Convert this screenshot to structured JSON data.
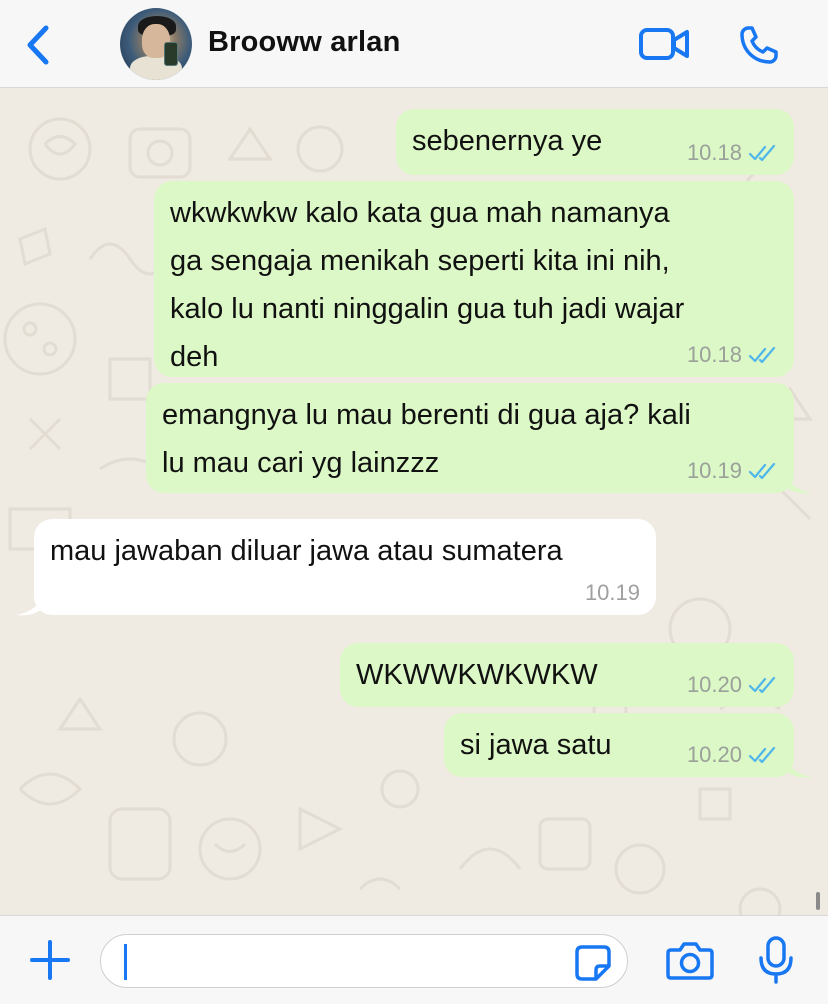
{
  "header": {
    "contact_name": "Brooww arlan"
  },
  "messages": [
    {
      "direction": "out",
      "lines": [
        "sebenernya ye"
      ],
      "time": "10.18",
      "read": true
    },
    {
      "direction": "out",
      "lines": [
        "wkwkwkw kalo kata gua mah namanya",
        "ga sengaja menikah seperti kita ini nih,",
        "kalo lu nanti ninggalin gua tuh jadi wajar",
        "deh"
      ],
      "time": "10.18",
      "read": true
    },
    {
      "direction": "out",
      "lines": [
        "emangnya lu mau berenti di gua aja? kali",
        "lu mau cari yg lainzzz"
      ],
      "time": "10.19",
      "read": true
    },
    {
      "direction": "in",
      "lines": [
        "mau jawaban diluar jawa atau sumatera"
      ],
      "time": "10.19"
    },
    {
      "direction": "out",
      "lines": [
        "WKWWKWKWKW"
      ],
      "time": "10.20",
      "read": true
    },
    {
      "direction": "out",
      "lines": [
        "si jawa satu"
      ],
      "time": "10.20",
      "read": true
    }
  ],
  "input": {
    "value": "",
    "placeholder": ""
  },
  "colors": {
    "accent": "#1877f2",
    "outgoing_bubble": "#dcf8c6",
    "incoming_bubble": "#ffffff",
    "read_ticks": "#4fb6ec",
    "wallpaper": "#efeae2"
  },
  "icons": {
    "back": "chevron-left-icon",
    "video": "video-camera-icon",
    "call": "phone-icon",
    "attach": "plus-icon",
    "sticker": "sticker-icon",
    "camera": "camera-icon",
    "mic": "microphone-icon"
  }
}
